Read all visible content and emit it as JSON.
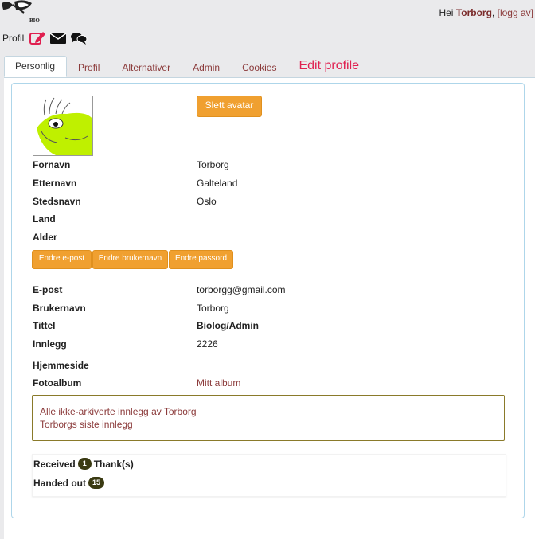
{
  "header": {
    "greeting": "Hei",
    "username": "Torborg",
    "separator": ",",
    "logout_open": "[",
    "logout_label": "logg av",
    "logout_close": "]",
    "logo_text": "BIO"
  },
  "profile_bar": {
    "label": "Profil",
    "icons": [
      "edit-icon",
      "mail-icon",
      "chat-icon"
    ]
  },
  "tabs": [
    {
      "label": "Personlig",
      "active": true
    },
    {
      "label": "Profil"
    },
    {
      "label": "Alternativer"
    },
    {
      "label": "Admin"
    },
    {
      "label": "Cookies"
    }
  ],
  "page_heading": "Edit profile",
  "delete_avatar_button": "Slett avatar",
  "personal": {
    "first_name": {
      "label": "Fornavn",
      "value": "Torborg"
    },
    "last_name": {
      "label": "Etternavn",
      "value": "Galteland"
    },
    "place": {
      "label": "Stedsnavn",
      "value": "Oslo"
    },
    "country": {
      "label": "Land",
      "value": ""
    },
    "age": {
      "label": "Alder",
      "value": ""
    }
  },
  "action_buttons": {
    "change_email": "Endre e-post",
    "change_username": "Endre brukernavn",
    "change_password": "Endre passord"
  },
  "account": {
    "email": {
      "label": "E-post",
      "value": "torborgg@gmail.com"
    },
    "username": {
      "label": "Brukernavn",
      "value": "Torborg"
    },
    "title": {
      "label": "Tittel",
      "value": "Biolog/Admin"
    },
    "posts": {
      "label": "Innlegg",
      "value": "2226"
    },
    "homepage": {
      "label": "Hjemmeside",
      "value": ""
    },
    "photo_album": {
      "label": "Fotoalbum",
      "value": "Mitt album"
    }
  },
  "links_box": {
    "non_archived": "Alle ikke-arkiverte innlegg av Torborg",
    "latest": "Torborgs siste innlegg"
  },
  "thanks": {
    "received_label": "Received",
    "received_count": "1",
    "received_suffix": "Thank(s)",
    "handed_out_label": "Handed out",
    "handed_out_count": "15"
  },
  "colors": {
    "accent_button": "#f0a030",
    "link": "#8b3a3a",
    "heading": "#e02050",
    "badge": "#3a3a12",
    "avatar_green": "#bff000"
  }
}
